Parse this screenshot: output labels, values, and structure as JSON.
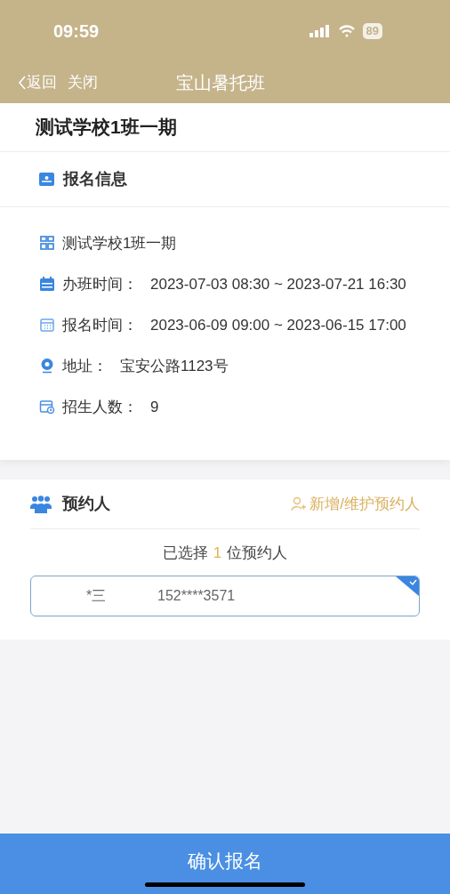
{
  "status_bar": {
    "time": "09:59",
    "battery": "89"
  },
  "nav": {
    "back": "返回",
    "close": "关闭",
    "title": "宝山暑托班"
  },
  "page_title": "测试学校1班一期",
  "info_section": {
    "title": "报名信息",
    "rows": [
      {
        "kind": "class",
        "value": "测试学校1班一期"
      },
      {
        "kind": "schedule",
        "label": "办班时间：",
        "value": "2023-07-03 08:30 ~ 2023-07-21 16:30"
      },
      {
        "kind": "signup",
        "label": "报名时间：",
        "value": "2023-06-09 09:00 ~ 2023-06-15 17:00"
      },
      {
        "kind": "address",
        "label": "地址：",
        "value": "宝安公路1123号"
      },
      {
        "kind": "quota",
        "label": "招生人数：",
        "value": "9"
      }
    ]
  },
  "reservation": {
    "title": "预约人",
    "manage_link": "新增/维护预约人",
    "summary": {
      "prefix": "已选择",
      "count": "1",
      "suffix": "位预约人"
    },
    "people": [
      {
        "name": "*三",
        "phone": "152****3571",
        "selected": true
      }
    ]
  },
  "submit": "确认报名"
}
